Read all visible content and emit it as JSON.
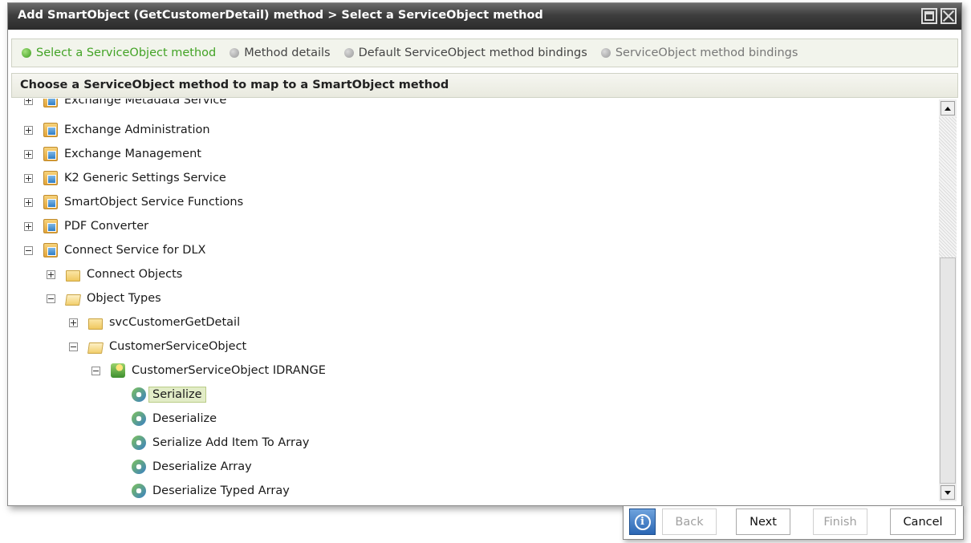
{
  "window": {
    "title": "Add SmartObject (GetCustomerDetail) method > Select a ServiceObject method"
  },
  "steps": [
    {
      "label": "Select a ServiceObject method",
      "state": "active"
    },
    {
      "label": "Method details",
      "state": "pending"
    },
    {
      "label": "Default ServiceObject method bindings",
      "state": "pending"
    },
    {
      "label": "ServiceObject method bindings",
      "state": "dim"
    }
  ],
  "panel": {
    "heading": "Choose a ServiceObject method to map to a SmartObject method"
  },
  "tree": {
    "items": [
      {
        "label": "Exchange Metadata Service",
        "icon": "service-icon",
        "expand": "plus"
      },
      {
        "label": "Exchange Administration",
        "icon": "service-icon",
        "expand": "plus"
      },
      {
        "label": "Exchange Management",
        "icon": "service-icon",
        "expand": "plus"
      },
      {
        "label": "K2 Generic Settings Service",
        "icon": "service-icon",
        "expand": "plus"
      },
      {
        "label": "SmartObject Service Functions",
        "icon": "service-icon",
        "expand": "plus"
      },
      {
        "label": "PDF Converter",
        "icon": "service-icon",
        "expand": "plus"
      },
      {
        "label": "Connect Service for DLX",
        "icon": "service-icon",
        "expand": "minus"
      },
      {
        "label": "Connect Objects",
        "icon": "folder-icon",
        "expand": "plus"
      },
      {
        "label": "Object Types",
        "icon": "folder-open-icon",
        "expand": "minus"
      },
      {
        "label": "svcCustomerGetDetail",
        "icon": "folder-icon",
        "expand": "plus"
      },
      {
        "label": "CustomerServiceObject",
        "icon": "folder-open-icon",
        "expand": "minus"
      },
      {
        "label": "CustomerServiceObject IDRANGE",
        "icon": "service-object-icon",
        "expand": "minus"
      },
      {
        "label": "Serialize",
        "icon": "method-icon",
        "selected": true
      },
      {
        "label": "Deserialize",
        "icon": "method-icon"
      },
      {
        "label": "Serialize Add Item To Array",
        "icon": "method-icon"
      },
      {
        "label": "Deserialize Array",
        "icon": "method-icon"
      },
      {
        "label": "Deserialize Typed Array",
        "icon": "method-icon"
      }
    ]
  },
  "footer": {
    "info_icon": "info-icon",
    "back_label": "Back",
    "next_label": "Next",
    "finish_label": "Finish",
    "cancel_label": "Cancel"
  },
  "colors": {
    "titlebar": "#3e3e3e",
    "active_step": "#43a326",
    "selection": "#e2ecc7",
    "info_button": "#2a66b4"
  }
}
